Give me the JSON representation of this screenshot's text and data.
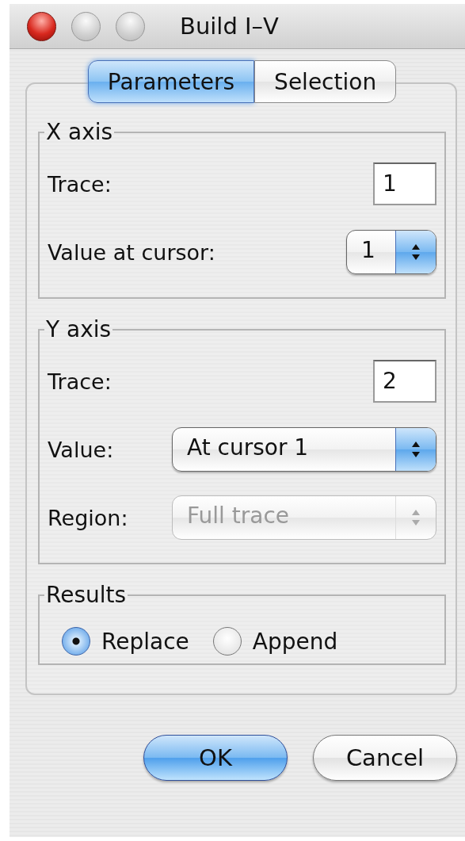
{
  "window": {
    "title": "Build I–V"
  },
  "tabs": [
    {
      "label": "Parameters",
      "selected": true
    },
    {
      "label": "Selection",
      "selected": false
    }
  ],
  "groups": [
    {
      "title": "X axis",
      "fields": [
        {
          "kind": "text",
          "label": "Trace:",
          "value": "1",
          "disabled": false
        },
        {
          "kind": "stepper",
          "label": "Value at cursor:",
          "value": "1",
          "disabled": false
        }
      ]
    },
    {
      "title": "Y axis",
      "fields": [
        {
          "kind": "text",
          "label": "Trace:",
          "value": "2",
          "disabled": false
        },
        {
          "kind": "popup",
          "label": "Value:",
          "value": "At cursor 1",
          "disabled": false
        },
        {
          "kind": "popup",
          "label": "Region:",
          "value": "Full trace",
          "disabled": true
        }
      ]
    }
  ],
  "results": {
    "title": "Results",
    "options": [
      {
        "label": "Replace",
        "selected": true
      },
      {
        "label": "Append",
        "selected": false
      }
    ]
  },
  "buttons": [
    {
      "label": "OK",
      "default": true
    },
    {
      "label": "Cancel",
      "default": false
    }
  ]
}
